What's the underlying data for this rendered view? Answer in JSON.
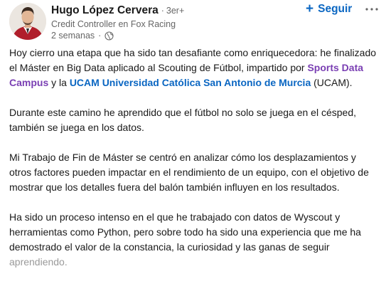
{
  "post": {
    "author": {
      "name": "Hugo López Cervera",
      "degree": "3er+",
      "headline": "Credit Controller en Fox Racing",
      "time": "2 semanas",
      "visibility_icon": "globe-icon"
    },
    "follow_label": "Seguir",
    "more_icon": "ellipsis-icon",
    "paragraphs": {
      "p1": {
        "part1": "Hoy cierro una etapa que ha sido tan desafiante como enriquecedora: he finalizado el Máster en Big Data aplicado al Scouting de Fútbol, impartido por ",
        "mention1": "Sports Data Campus",
        "part2": " y la ",
        "mention2": "UCAM Universidad Católica San Antonio de Murcia",
        "part3": " (UCAM)."
      },
      "p2": "Durante este camino he aprendido que el fútbol no solo se juega en el césped, también se juega en los datos.",
      "p3": "Mi Trabajo de Fin de Máster se centró en analizar cómo los desplazamientos y otros factores pueden impactar en el rendimiento de un equipo, con el objetivo de mostrar que los detalles fuera del balón también influyen en los resultados.",
      "p4": {
        "text": "Ha sido un proceso intenso en el que he trabajado con datos de Wyscout y herramientas como Python, pero sobre todo ha sido una experiencia que me ha demostrado el valor de la constancia, la curiosidad y las ganas de seguir ",
        "faded": "aprendiendo."
      }
    }
  },
  "colors": {
    "link_blue": "#0a66c2",
    "mention_purple": "#7a3fb3",
    "secondary_text": "#666666"
  }
}
